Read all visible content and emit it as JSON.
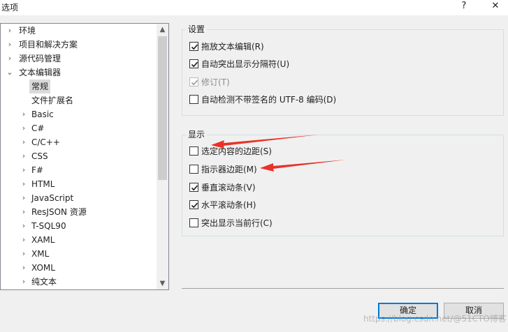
{
  "window": {
    "title": "选项",
    "help_glyph": "?",
    "close_glyph": "✕"
  },
  "tree": {
    "items": [
      {
        "label": "环境",
        "arrow": "›",
        "indent": 0
      },
      {
        "label": "项目和解决方案",
        "arrow": "›",
        "indent": 0
      },
      {
        "label": "源代码管理",
        "arrow": "›",
        "indent": 0
      },
      {
        "label": "文本编辑器",
        "arrow": "⌄",
        "indent": 0
      },
      {
        "label": "常规",
        "arrow": "",
        "indent": 1,
        "selected": true
      },
      {
        "label": "文件扩展名",
        "arrow": "",
        "indent": 1
      },
      {
        "label": "Basic",
        "arrow": "›",
        "indent": 1
      },
      {
        "label": "C#",
        "arrow": "›",
        "indent": 1
      },
      {
        "label": "C/C++",
        "arrow": "›",
        "indent": 1
      },
      {
        "label": "CSS",
        "arrow": "›",
        "indent": 1
      },
      {
        "label": "F#",
        "arrow": "›",
        "indent": 1
      },
      {
        "label": "HTML",
        "arrow": "›",
        "indent": 1
      },
      {
        "label": "JavaScript",
        "arrow": "›",
        "indent": 1
      },
      {
        "label": "ResJSON 资源",
        "arrow": "›",
        "indent": 1
      },
      {
        "label": "T-SQL90",
        "arrow": "›",
        "indent": 1
      },
      {
        "label": "XAML",
        "arrow": "›",
        "indent": 1
      },
      {
        "label": "XML",
        "arrow": "›",
        "indent": 1
      },
      {
        "label": "XOML",
        "arrow": "›",
        "indent": 1
      },
      {
        "label": "纯文本",
        "arrow": "›",
        "indent": 1
      }
    ],
    "scroll_up_glyph": "▲",
    "scroll_down_glyph": "▼"
  },
  "settings_group": {
    "title": "设置",
    "options": [
      {
        "label": "拖放文本编辑(R)",
        "checked": true,
        "disabled": false
      },
      {
        "label": "自动突出显示分隔符(U)",
        "checked": true,
        "disabled": false
      },
      {
        "label": "修订(T)",
        "checked": true,
        "disabled": true
      },
      {
        "label": "自动检测不带签名的 UTF-8 编码(D)",
        "checked": false,
        "disabled": false
      }
    ]
  },
  "display_group": {
    "title": "显示",
    "options": [
      {
        "label": "选定内容的边距(S)",
        "checked": false,
        "disabled": false
      },
      {
        "label": "指示器边距(M)",
        "checked": false,
        "disabled": false
      },
      {
        "label": "垂直滚动条(V)",
        "checked": true,
        "disabled": false
      },
      {
        "label": "水平滚动条(H)",
        "checked": true,
        "disabled": false
      },
      {
        "label": "突出显示当前行(C)",
        "checked": false,
        "disabled": false
      }
    ]
  },
  "buttons": {
    "ok": "确定",
    "cancel": "取消"
  },
  "annotation": {
    "arrow_color": "#e8322a"
  },
  "watermark": "https://blog.csdn.net/@51CTO博客"
}
